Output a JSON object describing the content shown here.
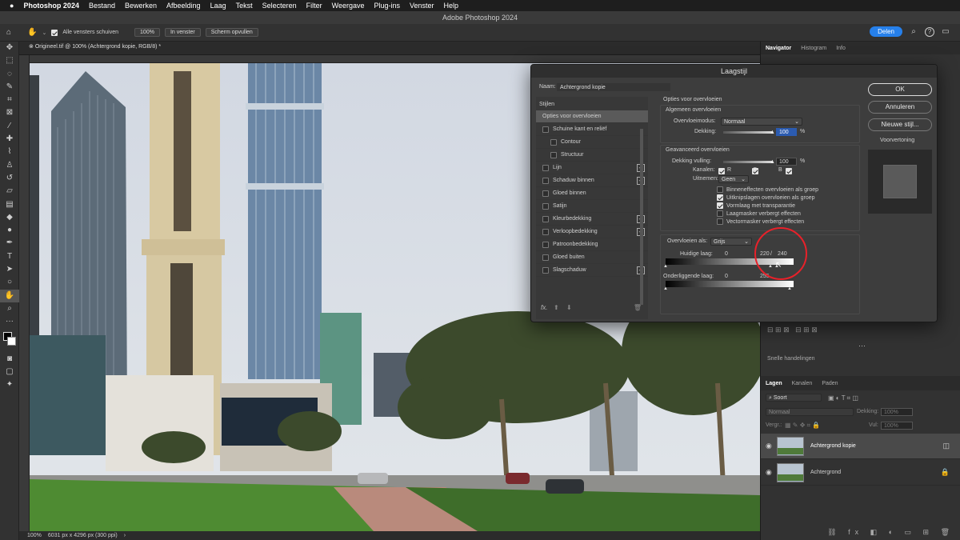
{
  "menubar": {
    "apple": "",
    "app": "Photoshop 2024",
    "items": [
      "Bestand",
      "Bewerken",
      "Afbeelding",
      "Laag",
      "Tekst",
      "Selecteren",
      "Filter",
      "Weergave",
      "Plug-ins",
      "Venster",
      "Help"
    ]
  },
  "window": {
    "title": "Adobe Photoshop 2024"
  },
  "options": {
    "scroll_all_label": "Alle vensters schuiven",
    "zoom_100": "100%",
    "fit_window": "In venster",
    "fill_screen": "Scherm opvullen",
    "share": "Delen"
  },
  "document": {
    "tab_title": "Origineel.tif @ 100% (Achtergrond kopie, RGB/8) *",
    "zoom": "100%",
    "doc_info": "6031 px x 4296 px (300 ppi)"
  },
  "right_tabs": [
    "Navigator",
    "Histogram",
    "Info"
  ],
  "layers_panel": {
    "tabs": [
      "Lagen",
      "Kanalen",
      "Paden"
    ],
    "search": "Soort",
    "blend_mode": "Normaal",
    "opacity_label": "Dekking:",
    "opacity": "100%",
    "lock_label": "Vergr.:",
    "fill_label": "Vul:",
    "fill": "100%",
    "layers": [
      {
        "name": "Achtergrond kopie"
      },
      {
        "name": "Achtergrond"
      }
    ],
    "adjust_label": "Snelle handelingen"
  },
  "dialog": {
    "title": "Laagstijl",
    "name_label": "Naam:",
    "name_value": "Achtergrond kopie",
    "styles_header": "Stijlen",
    "styles": [
      {
        "label": "Opties voor overvloeien",
        "checkbox": false,
        "plus": false,
        "indent": false,
        "selected": true
      },
      {
        "label": "Schuine kant en reliëf",
        "checkbox": true,
        "plus": false,
        "indent": false
      },
      {
        "label": "Contour",
        "checkbox": true,
        "plus": false,
        "indent": true
      },
      {
        "label": "Structuur",
        "checkbox": true,
        "plus": false,
        "indent": true
      },
      {
        "label": "Lijn",
        "checkbox": true,
        "plus": true,
        "indent": false
      },
      {
        "label": "Schaduw binnen",
        "checkbox": true,
        "plus": true,
        "indent": false
      },
      {
        "label": "Gloed binnen",
        "checkbox": true,
        "plus": false,
        "indent": false
      },
      {
        "label": "Satijn",
        "checkbox": true,
        "plus": false,
        "indent": false
      },
      {
        "label": "Kleurbedekking",
        "checkbox": true,
        "plus": true,
        "indent": false
      },
      {
        "label": "Verloopbedekking",
        "checkbox": true,
        "plus": true,
        "indent": false
      },
      {
        "label": "Patroonbedekking",
        "checkbox": true,
        "plus": false,
        "indent": false
      },
      {
        "label": "Gloed buiten",
        "checkbox": true,
        "plus": false,
        "indent": false
      },
      {
        "label": "Slagschaduw",
        "checkbox": true,
        "plus": true,
        "indent": false
      }
    ],
    "fx_label": "fx.",
    "options_header": "Opties voor overvloeien",
    "general_header": "Algemeen overvloeien",
    "blend_mode_label": "Overvloeimodus:",
    "blend_mode": "Normaal",
    "opacity_label": "Dekking:",
    "opacity_value": "100",
    "percent": "%",
    "advanced_header": "Geavanceerd overvloeien",
    "fill_opacity_label": "Dekking vulling:",
    "fill_opacity_value": "100",
    "channels_label": "Kanalen:",
    "channels": [
      "R",
      "G",
      "B"
    ],
    "knockout_label": "Uitnemen:",
    "knockout_value": "Geen",
    "advanced_options": [
      {
        "label": "Binneneffecten overvloeien als groep",
        "checked": false
      },
      {
        "label": "Uitknipslagen overvloeien als groep",
        "checked": true
      },
      {
        "label": "Vormlaag met transparantie",
        "checked": true
      },
      {
        "label": "Laagmasker verbergt effecten",
        "checked": false
      },
      {
        "label": "Vectormasker verbergt effecten",
        "checked": false
      }
    ],
    "blend_if_label": "Overvloeien als:",
    "blend_if_value": "Grijs",
    "this_layer_label": "Huidige laag:",
    "this_layer_min": "0",
    "this_layer_max": "220",
    "slash": "/",
    "this_layer_max2": "240",
    "underlying_label": "Onderliggende laag:",
    "underlying_min": "0",
    "underlying_max": "255",
    "buttons": {
      "ok": "OK",
      "cancel": "Annuleren",
      "new_style": "Nieuwe stijl...",
      "preview": "Voorvertoning"
    }
  },
  "colors": {
    "accent": "#2680eb",
    "highlight_circle": "#e8212a",
    "dialog_bg": "#3d3d3d"
  }
}
